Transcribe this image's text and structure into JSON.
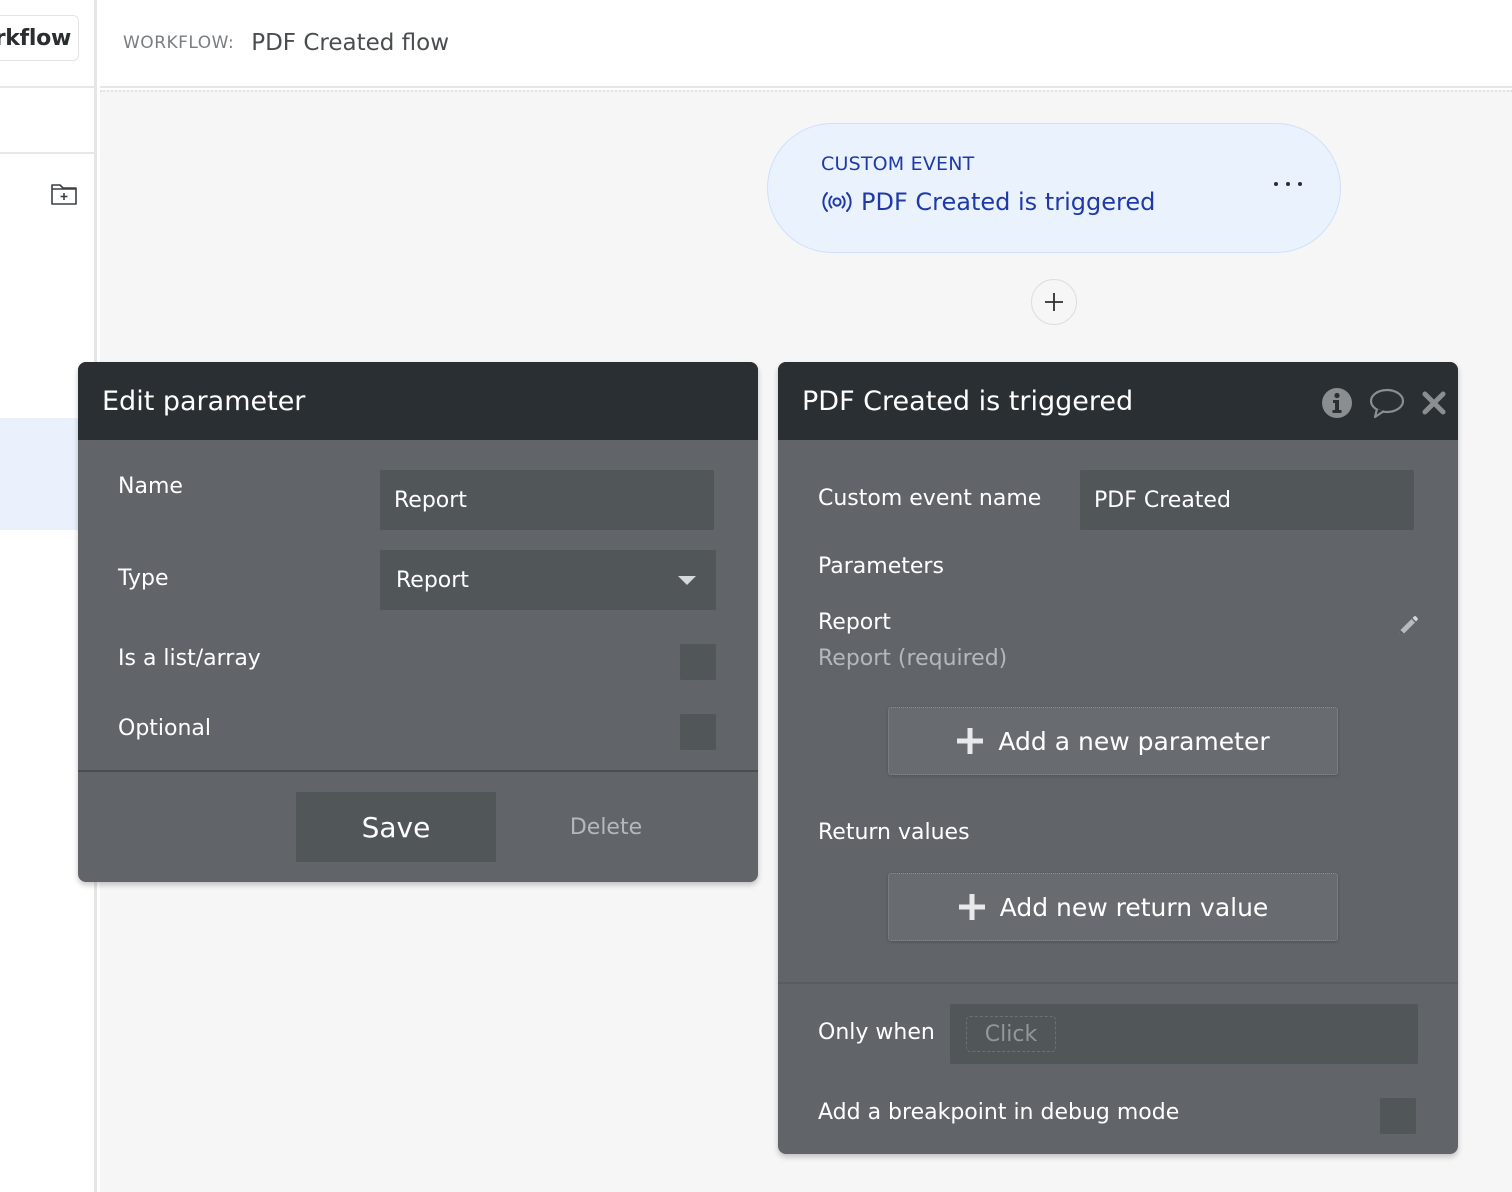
{
  "sidebar": {
    "workflow_button_label": "Workflow",
    "folder_icon": "folder-plus-icon"
  },
  "header": {
    "label": "WORKFLOW:",
    "title": "PDF Created flow"
  },
  "event_card": {
    "kind": "CUSTOM EVENT",
    "title": "PDF Created is triggered",
    "icon": "broadcast-icon",
    "more_icon": "more-horizontal-icon"
  },
  "add_step_icon": "plus-icon",
  "edit_parameter": {
    "title": "Edit parameter",
    "name_label": "Name",
    "name_value": "Report",
    "type_label": "Type",
    "type_value": "Report",
    "is_list_label": "Is a list/array",
    "is_list_checked": false,
    "optional_label": "Optional",
    "optional_checked": false,
    "save_label": "Save",
    "delete_label": "Delete"
  },
  "event_panel": {
    "title": "PDF Created is triggered",
    "header_icons": [
      "info-icon",
      "comment-icon",
      "close-icon"
    ],
    "custom_event_name_label": "Custom event name",
    "custom_event_name_value": "PDF Created",
    "parameters_label": "Parameters",
    "parameters": [
      {
        "name": "Report",
        "type": "Report (required)"
      }
    ],
    "add_parameter_label": "Add a new parameter",
    "return_values_label": "Return values",
    "add_return_value_label": "Add new return value",
    "only_when_label": "Only when",
    "only_when_placeholder": "Click",
    "breakpoint_label": "Add a breakpoint in debug mode",
    "breakpoint_checked": false
  },
  "colors": {
    "panel_header": "#292f32",
    "panel_body": "#616569",
    "input_bg": "#515659",
    "event_card_bg": "#eaf2fe",
    "event_card_text": "#1f3aa8",
    "canvas_bg": "#f6f6f6"
  }
}
